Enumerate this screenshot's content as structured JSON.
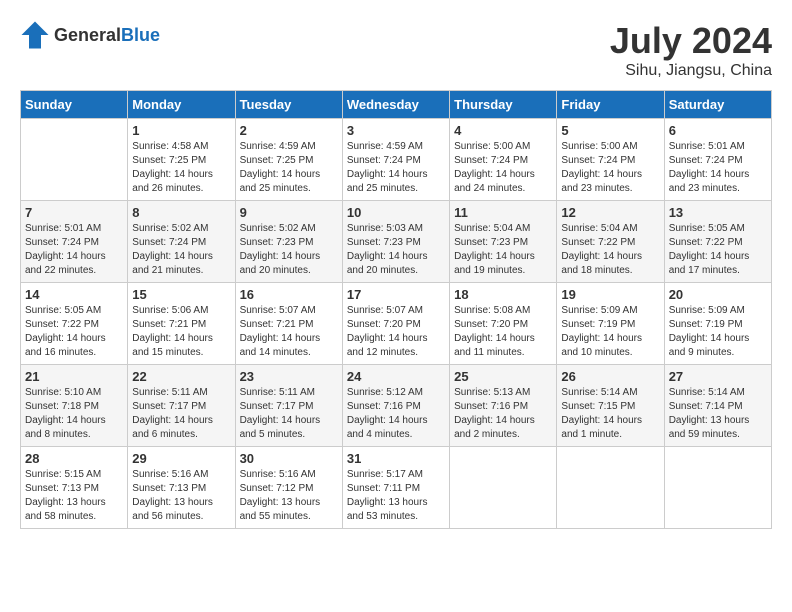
{
  "header": {
    "logo_general": "General",
    "logo_blue": "Blue",
    "title": "July 2024",
    "location": "Sihu, Jiangsu, China"
  },
  "calendar": {
    "days_of_week": [
      "Sunday",
      "Monday",
      "Tuesday",
      "Wednesday",
      "Thursday",
      "Friday",
      "Saturday"
    ],
    "weeks": [
      [
        {
          "day": "",
          "info": ""
        },
        {
          "day": "1",
          "info": "Sunrise: 4:58 AM\nSunset: 7:25 PM\nDaylight: 14 hours\nand 26 minutes."
        },
        {
          "day": "2",
          "info": "Sunrise: 4:59 AM\nSunset: 7:25 PM\nDaylight: 14 hours\nand 25 minutes."
        },
        {
          "day": "3",
          "info": "Sunrise: 4:59 AM\nSunset: 7:24 PM\nDaylight: 14 hours\nand 25 minutes."
        },
        {
          "day": "4",
          "info": "Sunrise: 5:00 AM\nSunset: 7:24 PM\nDaylight: 14 hours\nand 24 minutes."
        },
        {
          "day": "5",
          "info": "Sunrise: 5:00 AM\nSunset: 7:24 PM\nDaylight: 14 hours\nand 23 minutes."
        },
        {
          "day": "6",
          "info": "Sunrise: 5:01 AM\nSunset: 7:24 PM\nDaylight: 14 hours\nand 23 minutes."
        }
      ],
      [
        {
          "day": "7",
          "info": "Sunrise: 5:01 AM\nSunset: 7:24 PM\nDaylight: 14 hours\nand 22 minutes."
        },
        {
          "day": "8",
          "info": "Sunrise: 5:02 AM\nSunset: 7:24 PM\nDaylight: 14 hours\nand 21 minutes."
        },
        {
          "day": "9",
          "info": "Sunrise: 5:02 AM\nSunset: 7:23 PM\nDaylight: 14 hours\nand 20 minutes."
        },
        {
          "day": "10",
          "info": "Sunrise: 5:03 AM\nSunset: 7:23 PM\nDaylight: 14 hours\nand 20 minutes."
        },
        {
          "day": "11",
          "info": "Sunrise: 5:04 AM\nSunset: 7:23 PM\nDaylight: 14 hours\nand 19 minutes."
        },
        {
          "day": "12",
          "info": "Sunrise: 5:04 AM\nSunset: 7:22 PM\nDaylight: 14 hours\nand 18 minutes."
        },
        {
          "day": "13",
          "info": "Sunrise: 5:05 AM\nSunset: 7:22 PM\nDaylight: 14 hours\nand 17 minutes."
        }
      ],
      [
        {
          "day": "14",
          "info": "Sunrise: 5:05 AM\nSunset: 7:22 PM\nDaylight: 14 hours\nand 16 minutes."
        },
        {
          "day": "15",
          "info": "Sunrise: 5:06 AM\nSunset: 7:21 PM\nDaylight: 14 hours\nand 15 minutes."
        },
        {
          "day": "16",
          "info": "Sunrise: 5:07 AM\nSunset: 7:21 PM\nDaylight: 14 hours\nand 14 minutes."
        },
        {
          "day": "17",
          "info": "Sunrise: 5:07 AM\nSunset: 7:20 PM\nDaylight: 14 hours\nand 12 minutes."
        },
        {
          "day": "18",
          "info": "Sunrise: 5:08 AM\nSunset: 7:20 PM\nDaylight: 14 hours\nand 11 minutes."
        },
        {
          "day": "19",
          "info": "Sunrise: 5:09 AM\nSunset: 7:19 PM\nDaylight: 14 hours\nand 10 minutes."
        },
        {
          "day": "20",
          "info": "Sunrise: 5:09 AM\nSunset: 7:19 PM\nDaylight: 14 hours\nand 9 minutes."
        }
      ],
      [
        {
          "day": "21",
          "info": "Sunrise: 5:10 AM\nSunset: 7:18 PM\nDaylight: 14 hours\nand 8 minutes."
        },
        {
          "day": "22",
          "info": "Sunrise: 5:11 AM\nSunset: 7:17 PM\nDaylight: 14 hours\nand 6 minutes."
        },
        {
          "day": "23",
          "info": "Sunrise: 5:11 AM\nSunset: 7:17 PM\nDaylight: 14 hours\nand 5 minutes."
        },
        {
          "day": "24",
          "info": "Sunrise: 5:12 AM\nSunset: 7:16 PM\nDaylight: 14 hours\nand 4 minutes."
        },
        {
          "day": "25",
          "info": "Sunrise: 5:13 AM\nSunset: 7:16 PM\nDaylight: 14 hours\nand 2 minutes."
        },
        {
          "day": "26",
          "info": "Sunrise: 5:14 AM\nSunset: 7:15 PM\nDaylight: 14 hours\nand 1 minute."
        },
        {
          "day": "27",
          "info": "Sunrise: 5:14 AM\nSunset: 7:14 PM\nDaylight: 13 hours\nand 59 minutes."
        }
      ],
      [
        {
          "day": "28",
          "info": "Sunrise: 5:15 AM\nSunset: 7:13 PM\nDaylight: 13 hours\nand 58 minutes."
        },
        {
          "day": "29",
          "info": "Sunrise: 5:16 AM\nSunset: 7:13 PM\nDaylight: 13 hours\nand 56 minutes."
        },
        {
          "day": "30",
          "info": "Sunrise: 5:16 AM\nSunset: 7:12 PM\nDaylight: 13 hours\nand 55 minutes."
        },
        {
          "day": "31",
          "info": "Sunrise: 5:17 AM\nSunset: 7:11 PM\nDaylight: 13 hours\nand 53 minutes."
        },
        {
          "day": "",
          "info": ""
        },
        {
          "day": "",
          "info": ""
        },
        {
          "day": "",
          "info": ""
        }
      ]
    ]
  }
}
